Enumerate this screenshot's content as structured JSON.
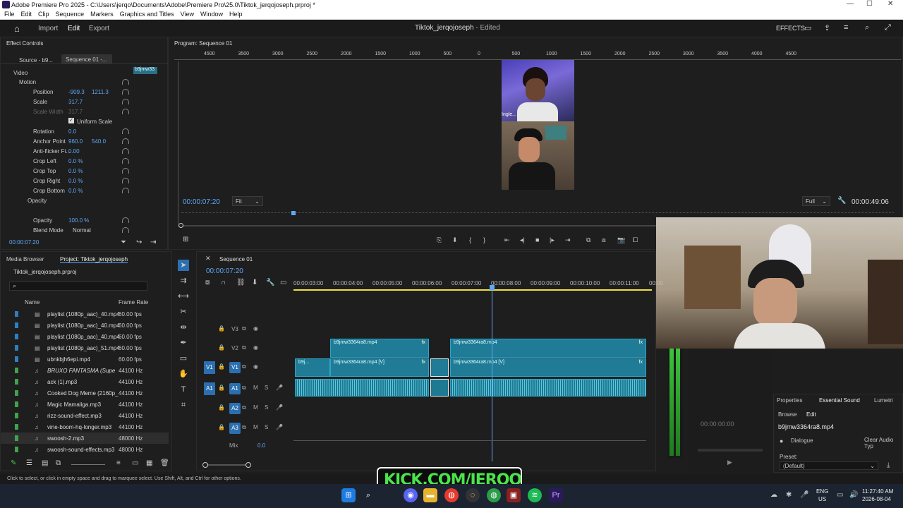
{
  "window": {
    "title": "Adobe Premiere Pro 2025 - C:\\Users\\jerqo\\Documents\\Adobe\\Premiere Pro\\25.0\\Tiktok_jerqojoseph.prproj *"
  },
  "menu": [
    "File",
    "Edit",
    "Clip",
    "Sequence",
    "Markers",
    "Graphics and Titles",
    "View",
    "Window",
    "Help"
  ],
  "workspace": {
    "tabs": [
      "Import",
      "Edit",
      "Export"
    ],
    "active_tab": "Edit",
    "project_title": "Tiktok_jerqojoseph",
    "status": "- Edited",
    "effects_label": "EFFECTS"
  },
  "effect_controls": {
    "panel_title": "Effect Controls",
    "source_tab": "Source - b9...",
    "sequence_tab": "Sequence 01 -...",
    "clip_label": "b9jmw33",
    "section_video": "Video",
    "rows": [
      {
        "label": "Motion",
        "v1": "",
        "v2": ""
      },
      {
        "label": "Position",
        "v1": "-909.3",
        "v2": "1211.3"
      },
      {
        "label": "Scale",
        "v1": "317.7",
        "v2": ""
      },
      {
        "label": "Scale Width",
        "v1": "317.7",
        "v2": ""
      },
      {
        "label": "Uniform Scale",
        "v1": "",
        "v2": ""
      },
      {
        "label": "Rotation",
        "v1": "0.0",
        "v2": ""
      },
      {
        "label": "Anchor Point",
        "v1": "960.0",
        "v2": "540.0"
      },
      {
        "label": "Anti-flicker Fi...",
        "v1": "0.00",
        "v2": ""
      },
      {
        "label": "Crop Left",
        "v1": "0.0 %",
        "v2": ""
      },
      {
        "label": "Crop Top",
        "v1": "0.0 %",
        "v2": ""
      },
      {
        "label": "Crop Right",
        "v1": "0.0 %",
        "v2": ""
      },
      {
        "label": "Crop Bottom",
        "v1": "0.0 %",
        "v2": ""
      },
      {
        "label": "Opacity",
        "v1": "",
        "v2": ""
      },
      {
        "label": "Opacity",
        "v1": "100.0 %",
        "v2": ""
      },
      {
        "label": "Blend Mode",
        "v1": "Normal",
        "v2": ""
      }
    ],
    "timecode": "00:00:07:20"
  },
  "program_monitor": {
    "title": "Program: Sequence 01",
    "ruler_labels": [
      "4500",
      "3500",
      "3000",
      "2500",
      "2000",
      "1500",
      "1000",
      "500",
      "0",
      "500",
      "1000",
      "1500",
      "2000",
      "2500",
      "3000",
      "3500",
      "4000",
      "4500"
    ],
    "timecode": "00:00:07:20",
    "fit": "Fit",
    "quality": "Full",
    "duration": "00:00:49:06",
    "overlay_name": "Ingle..."
  },
  "project": {
    "tabs": [
      "Media Browser",
      "Project: Tiktok_jerqojoseph"
    ],
    "file": "Tiktok_jerqojoseph.prproj",
    "col_name": "Name",
    "col_frame_rate": "Frame Rate",
    "items": [
      {
        "name": "playlist (1080p_aac)_40.mp4",
        "rate": "60.00 fps",
        "color": "#2f7fc0"
      },
      {
        "name": "playlist (1080p_aac)_40.mp4",
        "rate": "60.00 fps",
        "color": "#2f7fc0"
      },
      {
        "name": "playlist (1080p_aac)_40.mp4",
        "rate": "60.00 fps",
        "color": "#2f7fc0"
      },
      {
        "name": "playlist (1080p_aac)_51.mp4",
        "rate": "60.00 fps",
        "color": "#2f7fc0"
      },
      {
        "name": "ubnkbjh6epi.mp4",
        "rate": "60.00 fps",
        "color": "#2f7fc0"
      },
      {
        "name": "BRUXO FANTASMA (Supe",
        "rate": "44100 Hz",
        "color": "#3fa34d"
      },
      {
        "name": "ack (1).mp3",
        "rate": "44100 Hz",
        "color": "#3fa34d"
      },
      {
        "name": "Cooked Dog Meme (2160p_",
        "rate": "44100 Hz",
        "color": "#3fa34d"
      },
      {
        "name": "Magic Mamaliga.mp3",
        "rate": "44100 Hz",
        "color": "#3fa34d"
      },
      {
        "name": "rizz-sound-effect.mp3",
        "rate": "44100 Hz",
        "color": "#3fa34d"
      },
      {
        "name": "vine-boom-hq-longer.mp3",
        "rate": "44100 Hz",
        "color": "#3fa34d"
      },
      {
        "name": "swoosh-2.mp3",
        "rate": "48000 Hz",
        "color": "#3fa34d"
      },
      {
        "name": "swoosh-sound-effects.mp3",
        "rate": "48000 Hz",
        "color": "#3fa34d"
      }
    ]
  },
  "timeline": {
    "title": "Sequence 01",
    "timecode": "00:00:07:20",
    "ruler": [
      "00:00:03:00",
      "00:00:04:00",
      "00:00:05:00",
      "00:00:06:00",
      "00:00:07:00",
      "00:00:08:00",
      "00:00:09:00",
      "00:00:10:00",
      "00:00:11:00",
      "00:00"
    ],
    "tracks": [
      "V3",
      "V2",
      "V1",
      "A1",
      "A2",
      "A3"
    ],
    "source_patch": [
      "V1",
      "A1"
    ],
    "mix_label": "Mix",
    "mix_value": "0.0",
    "clips": {
      "v2a": "b9jmw3364ra8.mp4",
      "v2b": "b9jmw3364ra8.mp4",
      "v1a": "b9j...",
      "v1b": "b9jmw3364ra8.mp4 [V]",
      "v1c": "b9jmw3364ra8.mp4 [V]"
    }
  },
  "essential_sound": {
    "tabs": [
      "Properties",
      "Essential Sound",
      "Lumetri"
    ],
    "subtabs": [
      "Browse",
      "Edit"
    ],
    "clip": "b9jmw3364ra8.mp4",
    "dialogue": "Dialogue",
    "clear": "Clear Audio Typ",
    "preset_label": "Preset:",
    "preset_value": "(Default)",
    "audio_timecode": "00:00:00:00"
  },
  "statusbar": "Click to select, or click in empty space and drag to marquee select. Use Shift, Alt, and Ctrl for other options.",
  "watermark": "KICK.COM/JERQO",
  "taskbar": {
    "lang": "ENG",
    "region": "US",
    "time": "11:27:40 AM",
    "date": "2026-08-04"
  }
}
